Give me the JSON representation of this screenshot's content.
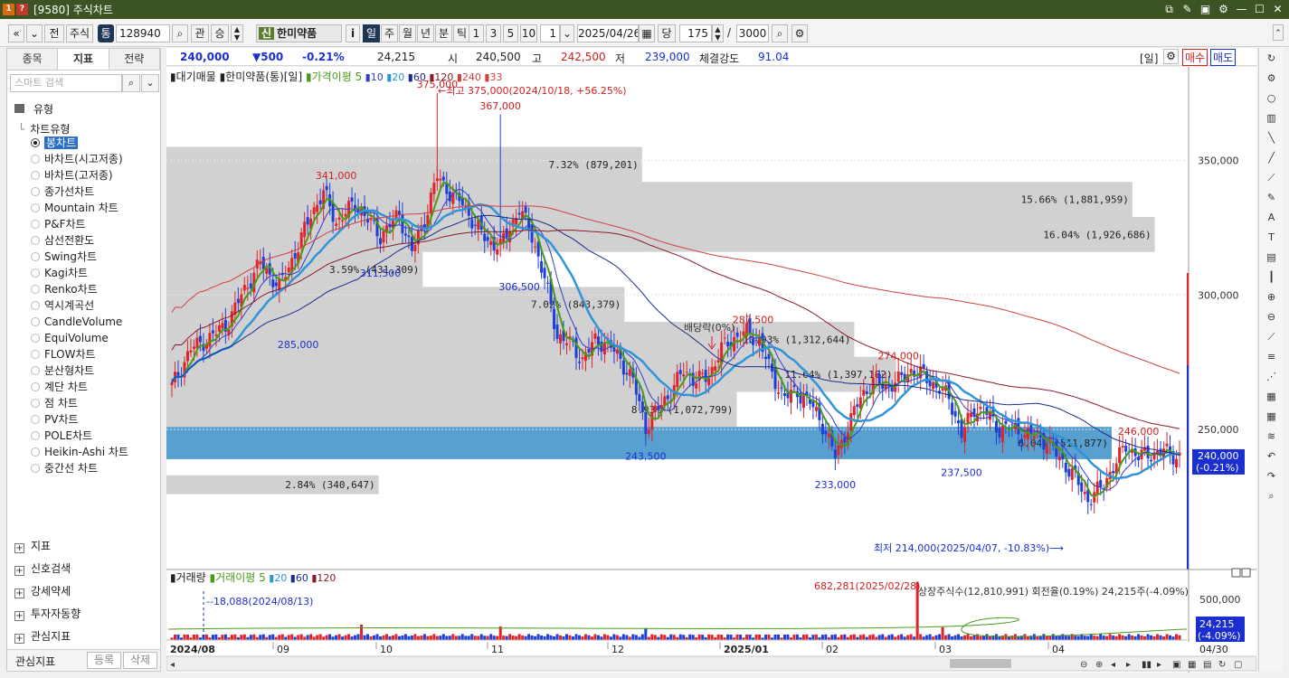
{
  "window": {
    "badge1": "1",
    "badge2": "?",
    "title": "[9580] 주식차트"
  },
  "toolbar": {
    "market": "주식",
    "market_tag": "통",
    "code": "128940",
    "btn_gwan": "관",
    "btn_seung": "승",
    "stock_tag": "신",
    "stock_name": "한미약품",
    "info_btn": "i",
    "periods": [
      "일",
      "주",
      "월",
      "년",
      "분",
      "틱"
    ],
    "active_period": "일",
    "units": [
      "1",
      "3",
      "5",
      "10"
    ],
    "unit_value": "1",
    "date": "2025/04/26",
    "btn_dang": "당",
    "count": "175",
    "sep": "/",
    "max_count": "3000",
    "nav_prev": "«",
    "nav_dd": "»",
    "btn_jeon": "전"
  },
  "left_panel": {
    "tabs": [
      "종목",
      "지표",
      "전략"
    ],
    "active_tab": "지표",
    "search_placeholder": "스마트 검색",
    "group_type": "유형",
    "chart_type_head": "차트유형",
    "chart_types": [
      "봉차트",
      "바차트(시고저종)",
      "바차트(고저종)",
      "종가선차트",
      "Mountain 차트",
      "P&F차트",
      "삼선전환도",
      "Swing차트",
      "Kagi차트",
      "Renko차트",
      "역시계곡선",
      "CandleVolume",
      "EquiVolume",
      "FLOW차트",
      "분산형차트",
      "계단 차트",
      "점 차트",
      "PV차트",
      "POLE차트",
      "Heikin-Ashi 차트",
      "중간선 차트"
    ],
    "selected": "봉차트",
    "sections": [
      "지표",
      "신호검색",
      "강세약세",
      "투자자동향",
      "관심지표"
    ],
    "bottom_label": "관심지표",
    "btn_register": "등록",
    "btn_delete": "삭제"
  },
  "quote": {
    "price": "240,000",
    "change": "▼500",
    "rate": "-0.21%",
    "volume": "24,215",
    "open_label": "시",
    "open": "240,500",
    "high_label": "고",
    "high": "242,500",
    "low_label": "저",
    "low": "239,000",
    "strength_label": "체결강도",
    "strength": "91.04",
    "period_tag": "[일]",
    "buy": "매수",
    "sell": "매도"
  },
  "legend": {
    "overlay": "대기매물",
    "stock": "한미약품(통)[일]",
    "ma_label": "가격이평",
    "ma_values": [
      "5",
      "10",
      "20",
      "60",
      "120",
      "240",
      "33"
    ],
    "vol_label": "거래량",
    "vol_ma_label": "거래이평",
    "vol_ma_values": [
      "5",
      "20",
      "60",
      "120"
    ]
  },
  "annotations": {
    "high_note": "←최고 375,000(2024/10/18, +56.25%)",
    "low_note": "최저 214,000(2025/04/07, -10.83%)⟶",
    "dividend": "배당락(0%)",
    "vol_max": "682,281(2025/02/28)",
    "vol_min": "--18,088(2024/08/13)",
    "listed": "상장주식수(12,810,991) 회전율(0.19%) 24,215주(-4.09%)",
    "labels": [
      "375,000",
      "367,000",
      "341,000",
      "311,500",
      "306,500",
      "285,000",
      "287,500",
      "243,500",
      "274,000",
      "233,000",
      "237,500",
      "246,000"
    ]
  },
  "chart_data": {
    "type": "candlestick",
    "title": "한미약품(통)[일]",
    "ylim": [
      198000,
      378000
    ],
    "y_ticks": [
      "350,000",
      "300,000",
      "250,000"
    ],
    "vol_ticks": [
      "500,000"
    ],
    "x_ticks": [
      "2024/08",
      "09",
      "10",
      "11",
      "12",
      "2025/01",
      "02",
      "03",
      "04",
      "04/30"
    ],
    "last_price": "240,000",
    "last_rate": "(-0.21%)",
    "last_volume": "24,215",
    "last_vol_rate": "(-4.09%)",
    "volume_profile": [
      {
        "low": 226000,
        "high": 233000,
        "label": "2.84% (340,647)"
      },
      {
        "low": 239000,
        "high": 251000,
        "label": "6.04% (511,877)",
        "highlight": true
      },
      {
        "low": 251000,
        "high": 264000,
        "label": "8.93% (1,072,799)"
      },
      {
        "low": 264000,
        "high": 277000,
        "label": "11.64% (1,397,182)"
      },
      {
        "low": 277000,
        "high": 290000,
        "label": "10.93% (1,312,644)"
      },
      {
        "low": 290000,
        "high": 303000,
        "label": "7.02% (843,379)"
      },
      {
        "low": 303000,
        "high": 316000,
        "label": "3.59% (431,309)"
      },
      {
        "low": 316000,
        "high": 329000,
        "label": "16.04% (1,926,686)"
      },
      {
        "low": 329000,
        "high": 342000,
        "label": "15.66% (1,881,959)"
      },
      {
        "low": 342000,
        "high": 355000,
        "label": "7.32% (879,201)"
      }
    ],
    "close_path": [
      [
        0,
        266000
      ],
      [
        6,
        280000
      ],
      [
        12,
        284000
      ],
      [
        18,
        290000
      ],
      [
        22,
        300000
      ],
      [
        28,
        312000
      ],
      [
        34,
        303000
      ],
      [
        40,
        318000
      ],
      [
        44,
        330000
      ],
      [
        48,
        338000
      ],
      [
        52,
        327000
      ],
      [
        58,
        334000
      ],
      [
        62,
        328000
      ],
      [
        66,
        322000
      ],
      [
        72,
        330000
      ],
      [
        76,
        316000
      ],
      [
        80,
        328000
      ],
      [
        84,
        344000
      ],
      [
        88,
        338000
      ],
      [
        92,
        334000
      ],
      [
        96,
        326000
      ],
      [
        100,
        320000
      ],
      [
        104,
        318000
      ],
      [
        110,
        332000
      ],
      [
        114,
        322000
      ],
      [
        118,
        306000
      ],
      [
        122,
        285000
      ],
      [
        126,
        282000
      ],
      [
        130,
        276000
      ],
      [
        134,
        283000
      ],
      [
        138,
        282000
      ],
      [
        142,
        276000
      ],
      [
        146,
        268000
      ],
      [
        150,
        251000
      ],
      [
        154,
        258000
      ],
      [
        158,
        264000
      ],
      [
        162,
        272000
      ],
      [
        166,
        268000
      ],
      [
        170,
        270000
      ],
      [
        174,
        280000
      ],
      [
        178,
        284000
      ],
      [
        182,
        286000
      ],
      [
        186,
        283000
      ],
      [
        190,
        270000
      ],
      [
        194,
        262000
      ],
      [
        198,
        264000
      ],
      [
        202,
        260000
      ],
      [
        206,
        252000
      ],
      [
        210,
        240000
      ],
      [
        214,
        251000
      ],
      [
        218,
        262000
      ],
      [
        222,
        268000
      ],
      [
        226,
        266000
      ],
      [
        230,
        268000
      ],
      [
        234,
        272000
      ],
      [
        238,
        270000
      ],
      [
        242,
        266000
      ],
      [
        246,
        262000
      ],
      [
        250,
        248000
      ],
      [
        254,
        258000
      ],
      [
        258,
        256000
      ],
      [
        262,
        250000
      ],
      [
        266,
        251000
      ],
      [
        270,
        248000
      ],
      [
        274,
        248000
      ],
      [
        278,
        244000
      ],
      [
        282,
        238000
      ],
      [
        286,
        232000
      ],
      [
        290,
        224000
      ],
      [
        294,
        228000
      ],
      [
        298,
        236000
      ],
      [
        302,
        244000
      ],
      [
        306,
        240000
      ],
      [
        310,
        241000
      ],
      [
        314,
        242000
      ],
      [
        318,
        240000
      ]
    ],
    "ma_series": [
      {
        "name": "5",
        "color": "#4a9a1a"
      },
      {
        "name": "10",
        "color": "#3040c8"
      },
      {
        "name": "20",
        "color": "#2f95d8"
      },
      {
        "name": "60",
        "color": "#1a2a90"
      },
      {
        "name": "120",
        "color": "#8a1a2a"
      },
      {
        "name": "240",
        "color": "#d04040"
      }
    ],
    "volume_spikes": [
      [
        60,
        180000
      ],
      [
        104,
        160000
      ],
      [
        150,
        140000
      ],
      [
        236,
        682281
      ],
      [
        244,
        150000
      ]
    ],
    "colors": {
      "up": "#e0242a",
      "down": "#1f3fd6",
      "profile": "#c9c9c9",
      "profile_hi": "#3a8fc7",
      "price_tag": "#1b2fd0"
    }
  },
  "right_tools": [
    "rotate",
    "gear",
    "circle",
    "bar",
    "line1",
    "line2",
    "line3",
    "pen",
    "auto",
    "text",
    "bars",
    "candle",
    "zoomin",
    "zoomout",
    "diag",
    "fib",
    "fan",
    "grid1",
    "grid2",
    "trend",
    "undo",
    "redo",
    "search"
  ]
}
